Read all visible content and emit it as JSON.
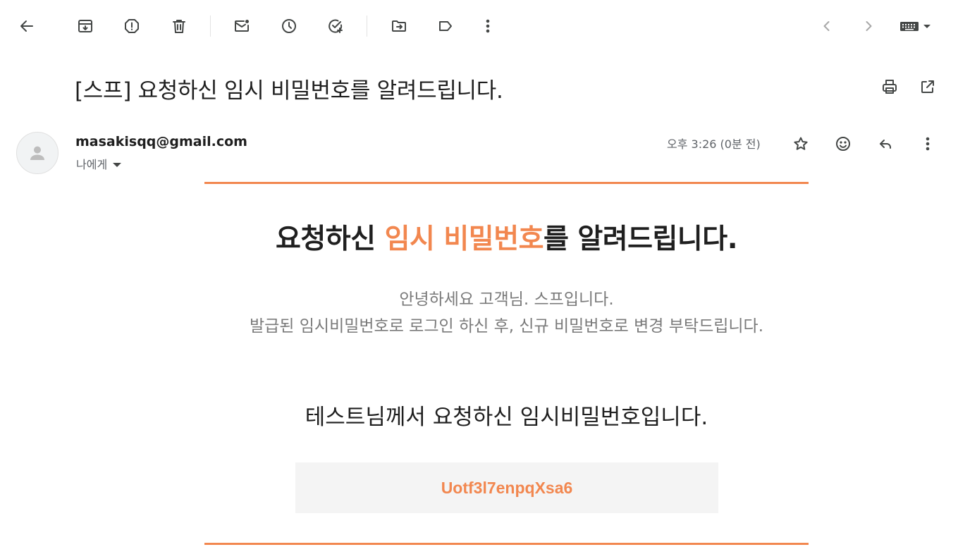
{
  "toolbar": {
    "back": "back-icon",
    "archive": "archive-icon",
    "spam": "report-spam-icon",
    "delete": "delete-icon",
    "mark_unread": "mark-unread-icon",
    "snooze": "snooze-icon",
    "add_task": "add-task-icon",
    "move": "move-to-icon",
    "label": "label-icon",
    "more": "more-vert-icon",
    "newer": "chevron-left-icon",
    "older": "chevron-right-icon",
    "input_tools": "keyboard-icon"
  },
  "subject": "[스프] 요청하신 임시 비밀번호를 알려드립니다.",
  "sender": {
    "email": "masakisqq@gmail.com",
    "recipient_label": "나에게",
    "timestamp": "오후 3:26 (0분 전)"
  },
  "body": {
    "headline_prefix": "요청하신 ",
    "headline_accent": "임시 비밀번호",
    "headline_suffix": "를 알려드립니다.",
    "greeting_line1": "안녕하세요 고객님. 스프입니다.",
    "greeting_line2": "발급된 임시비밀번호로 로그인 하신 후, 신규 비밀번호로 변경 부탁드립니다.",
    "notice": "테스트님께서 요청하신 임시비밀번호입니다.",
    "temp_password": "Uotf3l7enpqXsa6"
  },
  "colors": {
    "accent": "#f2874f",
    "text_primary": "#1f1f1f",
    "text_secondary": "#7a7a7a",
    "password_box_bg": "#f4f4f4"
  }
}
